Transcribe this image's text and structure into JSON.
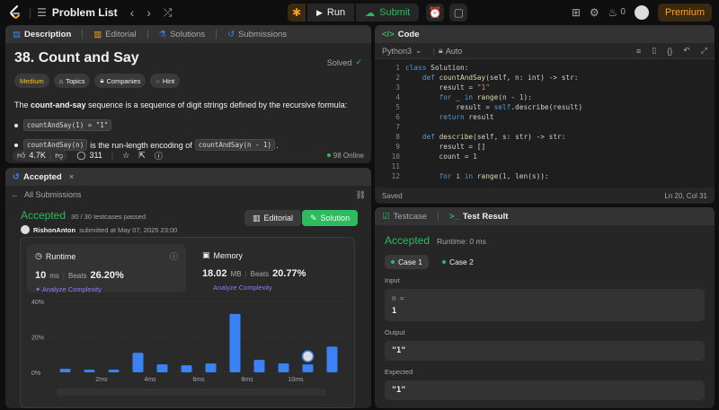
{
  "topbar": {
    "title": "Problem List",
    "run_label": "Run",
    "submit_label": "Submit",
    "streak": "0",
    "premium_label": "Premium"
  },
  "description": {
    "tabs": [
      "Description",
      "Editorial",
      "Solutions",
      "Submissions"
    ],
    "title": "38. Count and Say",
    "solved_label": "Solved",
    "chips": [
      "Medium",
      "Topics",
      "Companies",
      "Hint"
    ],
    "para_prefix": "The ",
    "para_bold": "count-and-say",
    "para_suffix": " sequence is a sequence of digit strings defined by the recursive formula:",
    "bullet1_code": "countAndSay(1) = \"1\"",
    "bullet2_code1": "countAndSay(n)",
    "bullet2_text": " is the run-length encoding of ",
    "bullet2_code2": "countAndSay(n - 1)",
    "bullet2_end": ".",
    "likes": "4.7K",
    "comments": "311",
    "online": "98 Online"
  },
  "code": {
    "tab_label": "Code",
    "language": "Python3",
    "auto_label": "Auto",
    "saved_label": "Saved",
    "cursor": "Ln 20, Col 31"
  },
  "submission": {
    "tab_label": "Accepted",
    "all_label": "All Submissions",
    "status": "Accepted",
    "testcases": "30 / 30 testcases passed",
    "user": "RishonAnton",
    "submitted": "submitted at May 07, 2025 23:00",
    "editorial_label": "Editorial",
    "solution_label": "Solution",
    "runtime_label": "Runtime",
    "runtime_value": "10",
    "runtime_unit": "ms",
    "runtime_beats_label": "Beats",
    "runtime_beats": "26.20%",
    "memory_label": "Memory",
    "memory_value": "18.02",
    "memory_unit": "MB",
    "memory_beats_label": "Beats",
    "memory_beats": "20.77%",
    "analyze_label": "Analyze Complexity"
  },
  "chart_data": {
    "type": "bar",
    "y_ticks": [
      "40%",
      "20%",
      "0%"
    ],
    "ylim": [
      0,
      40
    ],
    "x_ticks": [
      "2ms",
      "4ms",
      "6ms",
      "8ms",
      "10ms"
    ],
    "values": [
      2,
      1.5,
      1.5,
      11,
      4.5,
      4,
      5,
      33,
      7,
      5,
      4.5,
      14.5
    ],
    "highlight_index": 10
  },
  "testresult": {
    "tab1": "Testcase",
    "tab2": "Test Result",
    "status": "Accepted",
    "runtime": "Runtime: 0 ms",
    "case1": "Case 1",
    "case2": "Case 2",
    "input_label": "Input",
    "input_var": "n =",
    "input_value": "1",
    "output_label": "Output",
    "output_value": "\"1\"",
    "expected_label": "Expected",
    "expected_value": "\"1\""
  }
}
